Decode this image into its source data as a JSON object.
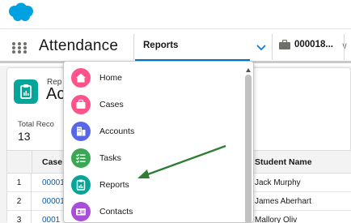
{
  "header": {
    "logo_icon": "salesforce-cloud-icon",
    "brand_color": "#00a1e0"
  },
  "nav": {
    "app_name": "Attendance",
    "tabs": [
      {
        "label": "Reports",
        "active": true,
        "has_dropdown": true
      },
      {
        "label": "000018...",
        "icon": "briefcase-icon",
        "has_dropdown": true,
        "closable": true
      }
    ],
    "chevron": "∨",
    "close": "✕",
    "accent_color": "#0176d3"
  },
  "page": {
    "subtitle": "Rep",
    "title": "Ac",
    "icon": "report-icon",
    "total_label": "Total Reco",
    "total_value": "13"
  },
  "table": {
    "columns": [
      "Case",
      "Student Name"
    ],
    "rows": [
      {
        "num": "1",
        "case": "00001",
        "student": "Jack Murphy"
      },
      {
        "num": "2",
        "case": "00001",
        "student": "James Aberhart"
      },
      {
        "num": "3",
        "case": "0001",
        "student": "Mallory Oliv"
      }
    ]
  },
  "dropdown": {
    "items": [
      {
        "label": "Home",
        "icon": "home-icon",
        "color": "#ff538a"
      },
      {
        "label": "Cases",
        "icon": "case-icon",
        "color": "#ff538a"
      },
      {
        "label": "Accounts",
        "icon": "account-icon",
        "color": "#5867e8"
      },
      {
        "label": "Tasks",
        "icon": "task-icon",
        "color": "#3ba755"
      },
      {
        "label": "Reports",
        "icon": "report-icon",
        "color": "#06a59a"
      },
      {
        "label": "Contacts",
        "icon": "contact-icon",
        "color": "#a94ed8"
      }
    ]
  },
  "annotation": {
    "arrow_color": "#2e7d32",
    "points_to": "Reports"
  }
}
